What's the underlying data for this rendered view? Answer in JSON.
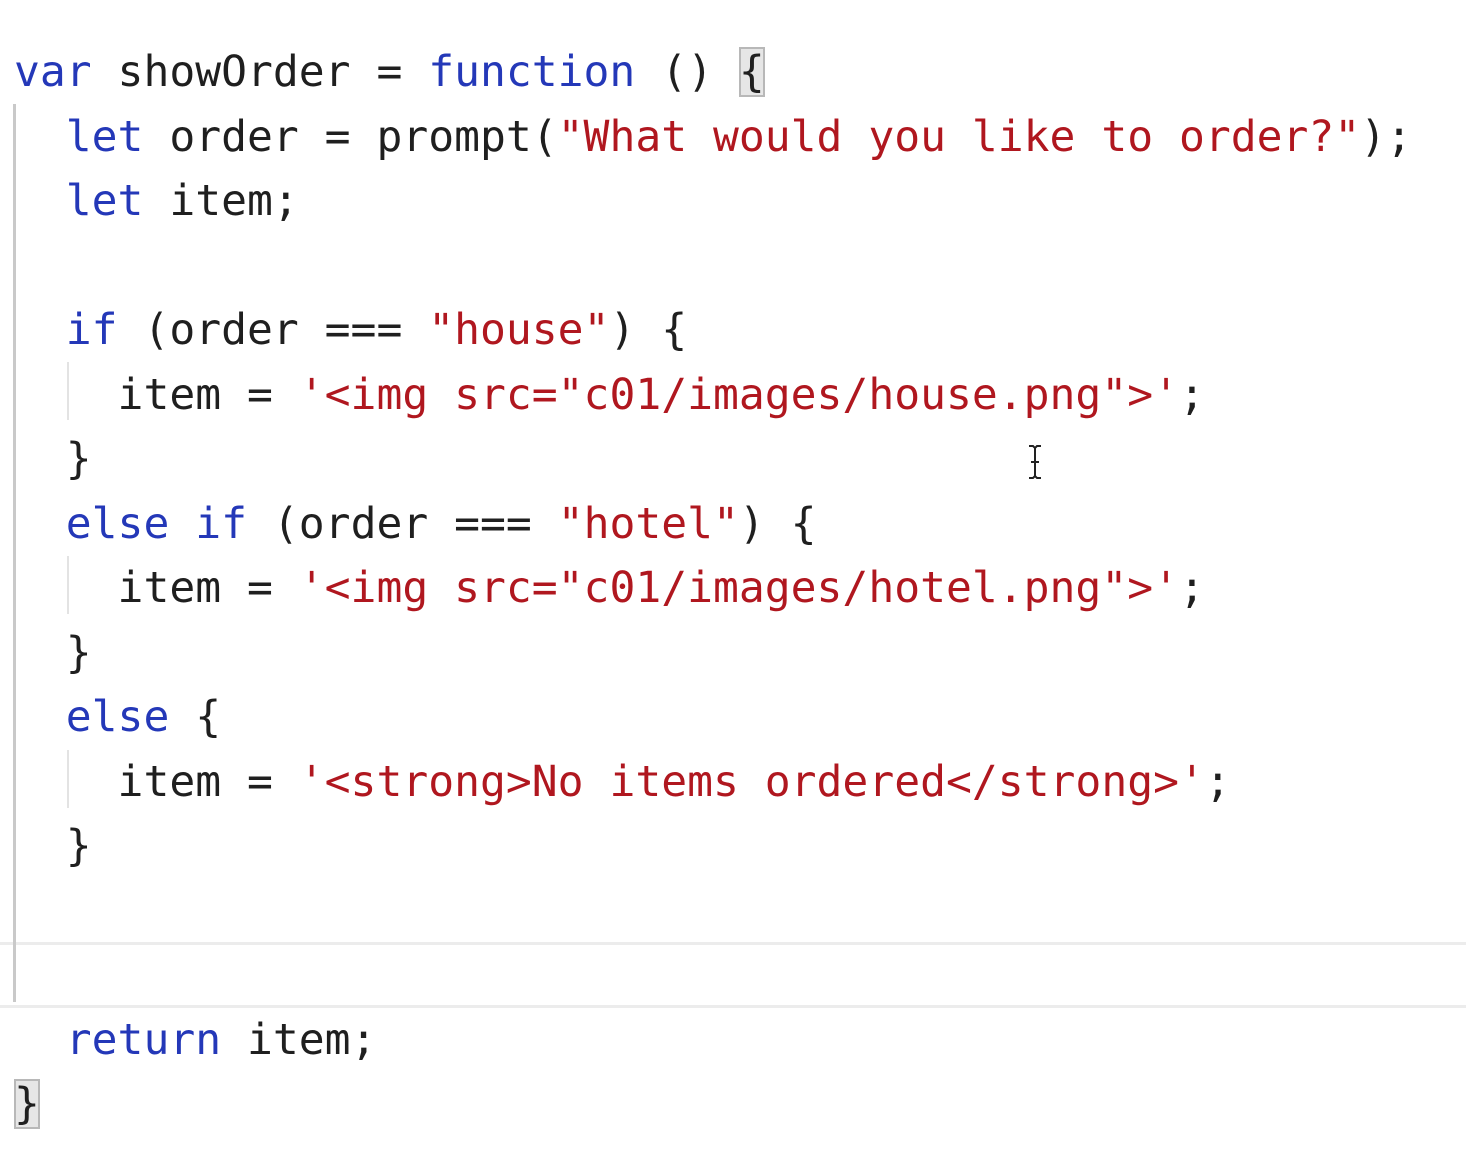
{
  "editor": {
    "lines": [
      [
        {
          "t": "var",
          "k": "kw"
        },
        {
          "t": " showOrder = ",
          "k": "plain"
        },
        {
          "t": "function",
          "k": "kw"
        },
        {
          "t": " () ",
          "k": "plain"
        },
        {
          "t": "{",
          "k": "plain",
          "hl": true
        }
      ],
      [
        {
          "t": "  ",
          "k": "plain"
        },
        {
          "t": "let",
          "k": "kw"
        },
        {
          "t": " order = prompt(",
          "k": "plain"
        },
        {
          "t": "\"What would you like to order?\"",
          "k": "str"
        },
        {
          "t": ");",
          "k": "plain"
        }
      ],
      [
        {
          "t": "  ",
          "k": "plain"
        },
        {
          "t": "let",
          "k": "kw"
        },
        {
          "t": " item;",
          "k": "plain"
        }
      ],
      [],
      [
        {
          "t": "  ",
          "k": "plain"
        },
        {
          "t": "if",
          "k": "kw"
        },
        {
          "t": " (order === ",
          "k": "plain"
        },
        {
          "t": "\"house\"",
          "k": "str"
        },
        {
          "t": ") {",
          "k": "plain"
        }
      ],
      [
        {
          "t": "    item = ",
          "k": "plain"
        },
        {
          "t": "'<img src=\"c01/images/house.png\">'",
          "k": "str"
        },
        {
          "t": ";",
          "k": "plain"
        }
      ],
      [
        {
          "t": "  }",
          "k": "plain"
        }
      ],
      [
        {
          "t": "  ",
          "k": "plain"
        },
        {
          "t": "else",
          "k": "kw"
        },
        {
          "t": " ",
          "k": "plain"
        },
        {
          "t": "if",
          "k": "kw"
        },
        {
          "t": " (order === ",
          "k": "plain"
        },
        {
          "t": "\"hotel\"",
          "k": "str"
        },
        {
          "t": ") {",
          "k": "plain"
        }
      ],
      [
        {
          "t": "    item = ",
          "k": "plain"
        },
        {
          "t": "'<img src=\"c01/images/hotel.png\">'",
          "k": "str"
        },
        {
          "t": ";",
          "k": "plain"
        }
      ],
      [
        {
          "t": "  }",
          "k": "plain"
        }
      ],
      [
        {
          "t": "  ",
          "k": "plain"
        },
        {
          "t": "else",
          "k": "kw"
        },
        {
          "t": " {",
          "k": "plain"
        }
      ],
      [
        {
          "t": "    item = ",
          "k": "plain"
        },
        {
          "t": "'<strong>No items ordered</strong>'",
          "k": "str"
        },
        {
          "t": ";",
          "k": "plain"
        }
      ],
      [
        {
          "t": "  }",
          "k": "plain"
        }
      ],
      [],
      [],
      [
        {
          "t": "  ",
          "k": "plain"
        },
        {
          "t": "return",
          "k": "kw"
        },
        {
          "t": " item;",
          "k": "plain"
        }
      ],
      [
        {
          "t": "}",
          "k": "plain",
          "hl": true
        }
      ]
    ],
    "colors": {
      "keyword": "#2438b8",
      "string": "#b0171f",
      "plain": "#1f1f1f",
      "background": "#ffffff"
    },
    "cursor_icon": "text-cursor-icon"
  }
}
